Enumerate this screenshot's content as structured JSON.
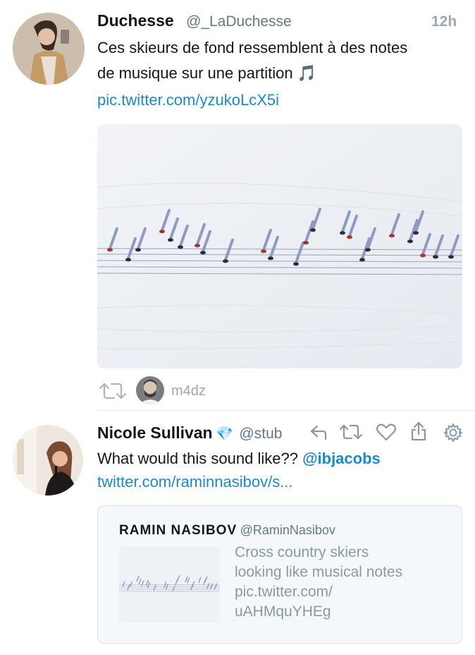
{
  "tweet1": {
    "name": "Duchesse",
    "handle": "@_LaDuchesse",
    "time": "12h",
    "text_line1": "Ces skieurs de fond ressemblent à des notes",
    "text_line2": "de musique sur une partition",
    "emoji": "🎵",
    "link": "pic.twitter.com/yzukoLcX5i",
    "retweeted_by": "m4dz"
  },
  "tweet2": {
    "name": "Nicole Sullivan",
    "badge": "💎",
    "handle": "@stub",
    "text": "What would this sound like??",
    "mention": "@ibjacobs",
    "link": "twitter.com/raminnasibov/s...",
    "quote": {
      "name": "RAMIN NASIBOV",
      "handle": "@RaminNasibov",
      "text_lines": [
        "Cross country skiers",
        "looking like musical notes",
        "pic.twitter.com/",
        "uAHMquYHEg"
      ]
    }
  },
  "colors": {
    "link": "#1d89c8",
    "muted": "#9aa6b0",
    "snow": "#eef1f5",
    "shadow": "#8a97c0"
  }
}
